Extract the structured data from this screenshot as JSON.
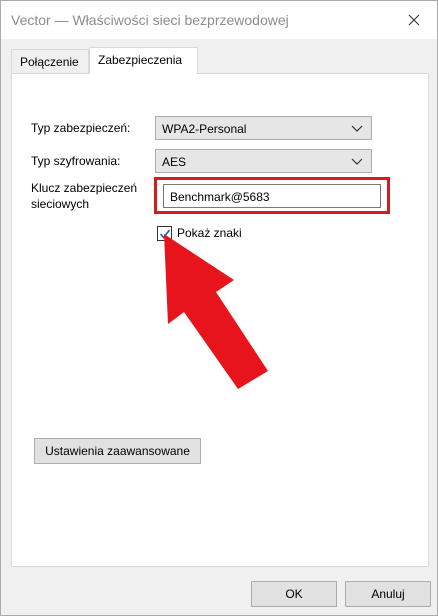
{
  "window": {
    "title": "Vector — Właściwości sieci bezprzewodowej",
    "close_icon": "close-icon"
  },
  "tabs": [
    {
      "label": "Połączenie",
      "active": false
    },
    {
      "label": "Zabezpieczenia",
      "active": true
    }
  ],
  "security": {
    "security_type_label": "Typ zabezpieczeń:",
    "security_type_value": "WPA2-Personal",
    "encryption_type_label": "Typ szyfrowania:",
    "encryption_type_value": "AES",
    "network_key_label_line1": "Klucz zabezpieczeń",
    "network_key_label_line2": "sieciowych",
    "network_key_value": "Benchmark@5683",
    "show_chars_label": "Pokaż znaki",
    "show_chars_checked": true,
    "advanced_button": "Ustawienia zaawansowane"
  },
  "footer": {
    "ok_label": "OK",
    "cancel_label": "Anuluj"
  },
  "colors": {
    "highlight": "#d71a1f",
    "checkbox_mark": "#1a5fb4"
  }
}
